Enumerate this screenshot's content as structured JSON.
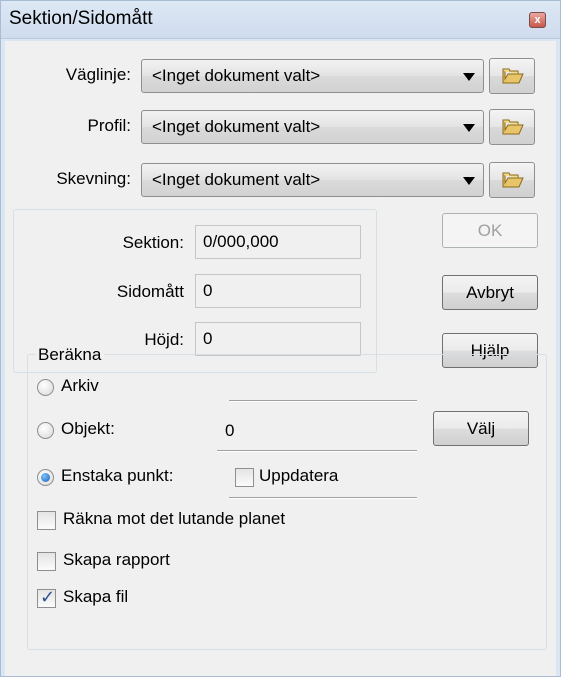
{
  "window": {
    "title": "Sektion/Sidomått",
    "close_glyph": "x"
  },
  "rows": [
    {
      "label": "Väglinje:",
      "value": "<Inget dokument valt>"
    },
    {
      "label": "Profil:",
      "value": "<Inget dokument valt>"
    },
    {
      "label": "Skevning:",
      "value": "<Inget dokument valt>"
    }
  ],
  "fields": [
    {
      "label": "Sektion:",
      "value": "0/000,000"
    },
    {
      "label": "Sidomått",
      "value": "0"
    },
    {
      "label": "Höjd:",
      "value": "0"
    }
  ],
  "buttons": {
    "ok": "OK",
    "cancel": "Avbryt",
    "help": "Hjälp",
    "choose": "Välj"
  },
  "calc": {
    "title": "Beräkna",
    "archive": {
      "label": "Arkiv",
      "selected": false
    },
    "object": {
      "label": "Objekt:",
      "value": "0",
      "selected": false
    },
    "single_point": {
      "label": "Enstaka punkt:",
      "selected": true
    },
    "update": {
      "label": "Uppdatera",
      "checked": false
    },
    "inclined_plane": {
      "label": "Räkna mot det lutande planet",
      "checked": false
    },
    "create_report": {
      "label": "Skapa rapport",
      "checked": false
    },
    "create_file": {
      "label": "Skapa fil",
      "checked": true
    }
  },
  "colors": {
    "titlebar": "#cfdcee",
    "dialog_bg": "#f0f0f0",
    "radio_dot": "#1a5fb4"
  },
  "icons": {
    "close": "close-icon",
    "folder": "folder-icon",
    "dropdown": "chevron-down-icon"
  }
}
